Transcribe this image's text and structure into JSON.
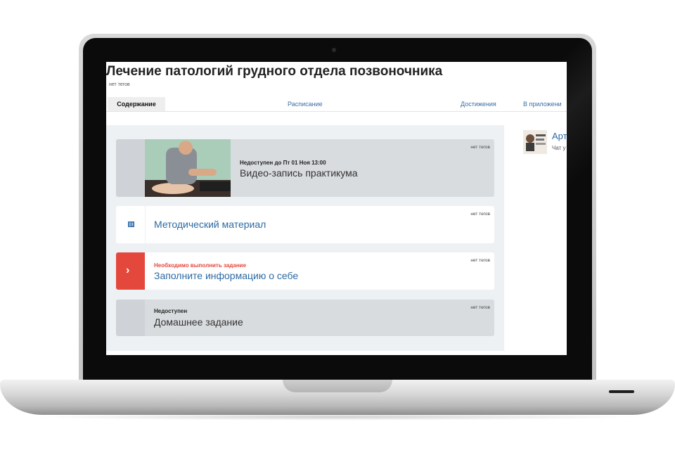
{
  "course": {
    "title": "Лечение патологий грудного отдела позвоночника",
    "tags": "нет тегов"
  },
  "tabs": [
    {
      "label": "Содержание",
      "active": true
    },
    {
      "label": "Расписание",
      "active": false
    },
    {
      "label": "Достижения",
      "active": false
    },
    {
      "label": "В приложени",
      "active": false
    }
  ],
  "lessons": [
    {
      "status": "Недоступен до Пт 01 Ноя 13:00",
      "title": "Видео-запись практикума",
      "tags": "нет тегов",
      "state": "locked"
    },
    {
      "status": "",
      "title": "Методический материал",
      "tags": "нет тегов",
      "state": "available",
      "icon": "document-icon"
    },
    {
      "status": "Необходимо выполнить задание",
      "title": "Заполните информацию о себе",
      "tags": "нет тегов",
      "state": "required",
      "icon": "chevron-right-icon"
    },
    {
      "status": "Недоступен",
      "title": "Домашнее задание",
      "tags": "нет тегов",
      "state": "locked"
    }
  ],
  "aside": {
    "title": "Арт",
    "subtitle": "Чат у"
  },
  "colors": {
    "accent_red": "#e4473c",
    "link_blue": "#2d6aa3",
    "locked_card": "#d9dcdf",
    "panel_bg": "#eef1f4"
  }
}
